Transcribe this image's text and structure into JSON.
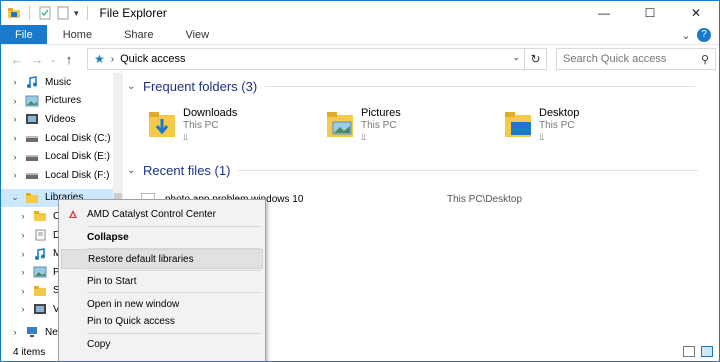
{
  "window": {
    "title": "File Explorer"
  },
  "ribbon": {
    "tabs": [
      "File",
      "Home",
      "Share",
      "View"
    ]
  },
  "address": {
    "path": "Quick access",
    "search_placeholder": "Search Quick access"
  },
  "nav": {
    "items": [
      {
        "label": "Music"
      },
      {
        "label": "Pictures"
      },
      {
        "label": "Videos"
      },
      {
        "label": "Local Disk (C:)"
      },
      {
        "label": "Local Disk (E:)"
      },
      {
        "label": "Local Disk (F:)"
      },
      {
        "label": "Libraries"
      },
      {
        "label": "Car"
      },
      {
        "label": "Doc"
      },
      {
        "label": "Mus"
      },
      {
        "label": "Pict"
      },
      {
        "label": "Sav"
      },
      {
        "label": "Vide"
      },
      {
        "label": "Netw"
      }
    ]
  },
  "status": {
    "items_count": "4 items"
  },
  "content": {
    "frequent_header": "Frequent folders (3)",
    "folders": [
      {
        "name": "Downloads",
        "location": "This PC"
      },
      {
        "name": "Pictures",
        "location": "This PC"
      },
      {
        "name": "Desktop",
        "location": "This PC"
      }
    ],
    "recent_header": "Recent files (1)",
    "recent": [
      {
        "name": "photo app problem windows 10",
        "path": "This PC\\Desktop"
      }
    ]
  },
  "context_menu": {
    "items": [
      "AMD Catalyst Control Center",
      "Collapse",
      "Restore default libraries",
      "Pin to Start",
      "Open in new window",
      "Pin to Quick access",
      "Copy"
    ]
  },
  "colors": {
    "accent": "#1979ca",
    "folder": "#f5c94a",
    "header_text": "#1e3287"
  }
}
